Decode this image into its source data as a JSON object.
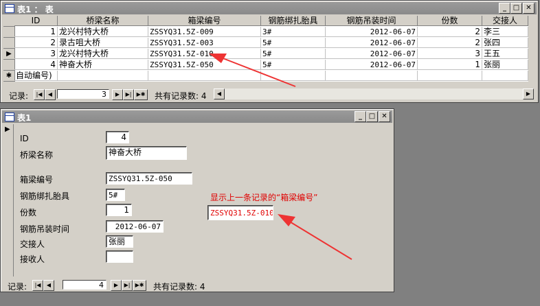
{
  "datasheet": {
    "title": "表1 ： 表",
    "columns": [
      "ID",
      "桥梁名称",
      "箱梁编号",
      "钢筋绑扎胎具",
      "钢筋吊装时间",
      "份数",
      "交接人"
    ],
    "rows": [
      [
        "1",
        "龙兴村特大桥",
        "ZSSYQ31.5Z-009",
        "3#",
        "2012-06-07",
        "2",
        "李三"
      ],
      [
        "2",
        "录古咀大桥",
        "ZSSYQ31.5Z-003",
        "5#",
        "2012-06-07",
        "2",
        "张四"
      ],
      [
        "3",
        "龙兴村特大桥",
        "ZSSYQ31.5Z-010",
        "5#",
        "2012-06-07",
        "3",
        "王五"
      ],
      [
        "4",
        "神奋大桥",
        "ZSSYQ31.5Z-050",
        "5#",
        "2012-06-07",
        "1",
        "张丽"
      ]
    ],
    "new_row_text": "自动编号)",
    "new_row_marker": "✱",
    "current_marker": "▶",
    "nav": {
      "label": "记录:",
      "current": "3",
      "total_text": "共有记录数: 4"
    }
  },
  "form": {
    "title": "表1",
    "fields": {
      "id_label": "ID",
      "id_value": "4",
      "bridge_label": "桥梁名称",
      "bridge_value": "神奋大桥",
      "beam_label": "箱梁编号",
      "beam_value": "ZSSYQ31.5Z-050",
      "jig_label": "钢筋绑扎胎具",
      "jig_value": "5#",
      "copies_label": "份数",
      "copies_value": "1",
      "time_label": "钢筋吊装时间",
      "time_value": "2012-06-07",
      "handover_label": "交接人",
      "handover_value": "张丽",
      "receiver_label": "接收人",
      "receiver_value": ""
    },
    "annotation": "显示上一条记录的“箱梁编号”",
    "prev_beam_value": "ZSSYQ31.5Z-010",
    "nav": {
      "label": "记录:",
      "current": "4",
      "total_text": "共有记录数: 4"
    }
  },
  "window_buttons": {
    "min": "_",
    "max": "□",
    "close": "✕"
  },
  "nav_icons": {
    "first": "|◀",
    "prev": "◀",
    "next": "▶",
    "last": "▶|",
    "new": "▶✱"
  },
  "colors": {
    "annotation": "#e00000",
    "arrow": "#ee3333"
  }
}
